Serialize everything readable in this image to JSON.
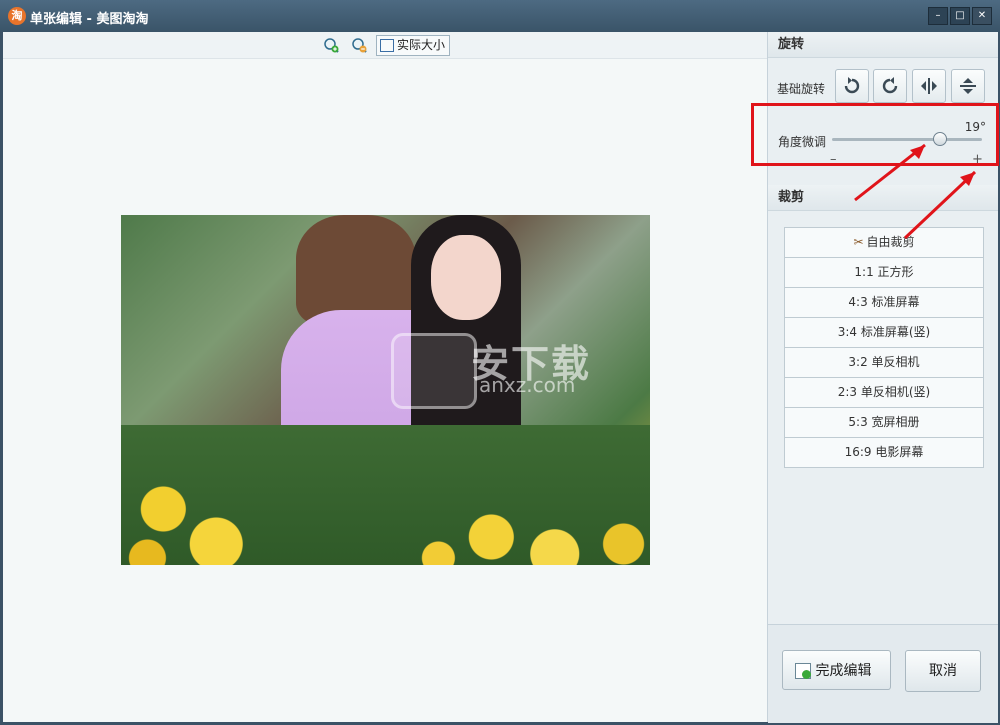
{
  "window": {
    "logo": "淘",
    "title": "单张编辑 - 美图淘淘",
    "controls": {
      "minimize": "–",
      "maximize": "□",
      "close": "✕"
    }
  },
  "toolbar": {
    "zoom_in_icon": "zoom-in-icon",
    "zoom_out_icon": "zoom-out-icon",
    "actual_size": "实际大小"
  },
  "photo": {
    "watermark_text": "安下载",
    "watermark_sub": "anxz.com"
  },
  "rotate": {
    "heading": "旋转",
    "basic_label": "基础旋转",
    "buttons": [
      "rotate-left-icon",
      "rotate-right-icon",
      "flip-horizontal-icon",
      "flip-vertical-icon"
    ]
  },
  "angle": {
    "label": "角度微调",
    "value_text": "19°",
    "slider_fraction": 0.72,
    "min_symbol": "–",
    "plus_symbol": "+"
  },
  "crop": {
    "heading": "裁剪",
    "items": [
      "自由裁剪",
      "1:1 正方形",
      "4:3 标准屏幕",
      "3:4 标准屏幕(竖)",
      "3:2 单反相机",
      "2:3 单反相机(竖)",
      "5:3 宽屏相册",
      "16:9 电影屏幕"
    ]
  },
  "actions": {
    "done": "完成编辑",
    "cancel": "取消"
  },
  "colors": {
    "highlight_box": "#e0141a",
    "arrow": "#e0141a"
  }
}
